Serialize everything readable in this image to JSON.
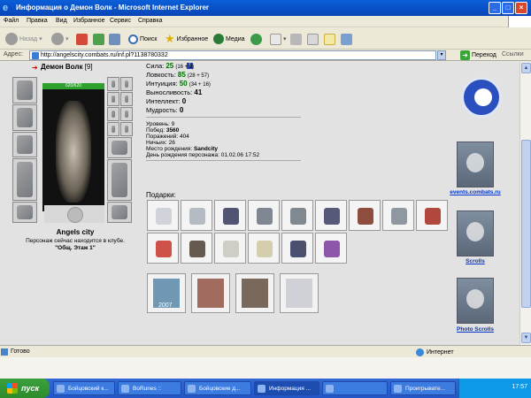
{
  "window": {
    "title": "Информация о Демон Волк - Microsoft Internet Explorer",
    "controls": [
      "_",
      "□",
      "×"
    ]
  },
  "menu": [
    "Файл",
    "Правка",
    "Вид",
    "Избранное",
    "Сервис",
    "Справка"
  ],
  "toolbar": {
    "back": "Назад",
    "search": "Поиск",
    "favorites": "Избранное",
    "media": "Медиа"
  },
  "address": {
    "label": "Адрес:",
    "url": "http://angelscity.combats.ru/inf.pl?1138780332",
    "go": "Переход",
    "links": "Ссылки"
  },
  "character": {
    "name": "Демон Волк",
    "level": "[9]",
    "info_badge": "i",
    "hp": "620/620",
    "city": "Angels city",
    "location_line": "Персонаж сейчас находится в клубе.",
    "location": "\"Общ. Этаж 1\""
  },
  "stats": [
    {
      "label": "Сила:",
      "value": "25",
      "mod": "(16 + 9)"
    },
    {
      "label": "Ловкость:",
      "value": "85",
      "mod": "(28 + 57)"
    },
    {
      "label": "Интуиция:",
      "value": "50",
      "mod": "(34 + 16)"
    },
    {
      "label": "Выносливость:",
      "value": "41",
      "mod": ""
    },
    {
      "label": "Интеллект:",
      "value": "0",
      "mod": ""
    },
    {
      "label": "Мудрость:",
      "value": "0",
      "mod": ""
    }
  ],
  "info": [
    {
      "label": "Уровень:",
      "value": "9"
    },
    {
      "label": "Побед:",
      "value": "3560"
    },
    {
      "label": "Поражений:",
      "value": "404"
    },
    {
      "label": "Ничьих:",
      "value": "26"
    },
    {
      "label": "Место рождения:",
      "value": "Sandcity"
    },
    {
      "label": "День рождения персонажа:",
      "value": "01.02.06 17:52"
    }
  ],
  "gifts": {
    "title": "Подарки:",
    "row1_colors": [
      "#c9cdd4",
      "#a8b0b8",
      "#34385c",
      "#6a7380",
      "#6b747e",
      "#3a3e62",
      "#7a3020",
      "#7d8690",
      "#a4291c"
    ],
    "row2_colors": [
      "#c8352a",
      "#4a4030",
      "#c9c4bd",
      "#cfc7a0",
      "#2c3256",
      "#7a3a9c"
    ],
    "big_colors": [
      "#4f7fa2",
      "#8c4a3a",
      "#5a4636",
      "#c7c7d0"
    ],
    "big_label": "2007"
  },
  "sidebar": {
    "banners": [
      {
        "label": "events.combats.ru",
        "caption": "event"
      },
      {
        "label": "Scrolls",
        "caption": "scrolls"
      },
      {
        "label": "Photo Scrolls",
        "caption": "photo"
      }
    ]
  },
  "status": {
    "text": "Готово",
    "zone": "Интернет"
  },
  "taskbar": {
    "start": "пуск",
    "tasks": [
      "Бойцовский к...",
      "BoRunes ::",
      "Бойцовские д...",
      "Информация ...",
      "",
      "Проигрывате..."
    ],
    "clock": "17:57"
  }
}
